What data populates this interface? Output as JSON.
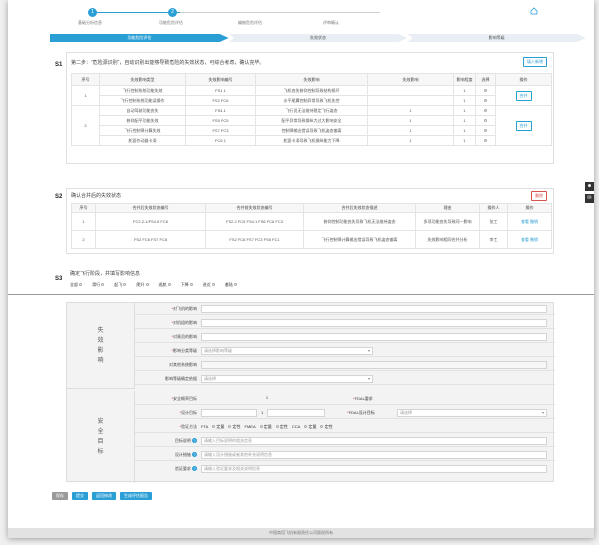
{
  "stepper": {
    "steps": [
      {
        "num": "1",
        "label": "基础分析信息"
      },
      {
        "num": "2",
        "label": "功能危险评估"
      },
      {
        "num": "3",
        "label": "编制危险评估"
      },
      {
        "num": "4",
        "label": "评审确认"
      }
    ]
  },
  "phases": [
    "功能危险评估",
    "失效状态",
    "影响等级"
  ],
  "s1": {
    "tag": "S1",
    "title": "第二步：“危险源识别”，自动识别出能够导致危险的失效状态，可综合考虑，确认完毕。",
    "add_label": "填入新增",
    "headers": [
      "序号",
      "失效影响类型",
      "失效影响编号",
      "失效影响",
      "失效影响",
      "影响程度",
      "选择",
      "操作"
    ],
    "groups": [
      {
        "index": "1",
        "rows": [
          [
            "飞行控制系统功能失效",
            "FS1.1",
            "飞机丧失俯仰控制导致结构损坏",
            "",
            "1"
          ],
          [
            "飞行控制系统功能误操作",
            "FS2 FC6",
            "水平尾翼控制异常导致飞机失控",
            "",
            "1"
          ]
        ],
        "action": "合并"
      },
      {
        "index": "2",
        "rows": [
          [
            "自动驾驶功能丧失",
            "FS4.1",
            "飞行员无法维持稳定飞行姿态",
            "1",
            "1"
          ],
          [
            "俯仰配平功能失效",
            "FS5 FC5",
            "配平异常导致操纵力过大影响安全",
            "1",
            "1"
          ],
          [
            "飞行控制律计算失效",
            "FS7 FC3",
            "控制律输出错误导致飞机姿态偏离",
            "1",
            "1"
          ],
          [
            "舵面作动器卡滞",
            "FC6 1",
            "舵面卡滞导致飞机操纵能力下降",
            "1",
            "1"
          ]
        ],
        "action": "合并"
      }
    ]
  },
  "s2": {
    "tag": "S2",
    "title": "确认合并后的失效状态",
    "delete_label": "删除",
    "headers": [
      "序号",
      "合并后失效状态编号",
      "合并前失效状态编号",
      "合并后失效状态描述",
      "理由",
      "操作人",
      "操作"
    ],
    "rows": [
      [
        "1",
        "FC2.2-1/FS4.5 FC6",
        "FS2.2 FC5 FS4.1 FS6 FC6 FC3",
        "俯仰控制功能丧失导致飞机无法维持姿态",
        "多项功能丧失导致同一影响",
        "张工",
        "查看 撤销"
      ],
      [
        "2",
        "FS2 FC6 FS7 FC6",
        "FS2 FC6 FS7 FC3 FS6 FC1",
        "飞行控制律计算输出错误导致飞机姿态偏离",
        "失效影响相同合并分析",
        "李工",
        "查看 撤销"
      ]
    ]
  },
  "s3": {
    "tag": "S3",
    "title": "确定飞行阶段，并填写影响信息",
    "phases": [
      "全部",
      "滑行",
      "起飞",
      "爬升",
      "巡航",
      "下降",
      "进近",
      "着陆"
    ]
  },
  "form": {
    "impact_group": "失效影响",
    "impact_rows": [
      {
        "label": "对飞机的影响",
        "req": "*",
        "value": "",
        "type": "input"
      },
      {
        "label": "对机组的影响",
        "req": "*",
        "value": "",
        "type": "input"
      },
      {
        "label": "对乘员的影响",
        "req": "*",
        "value": "",
        "type": "input"
      },
      {
        "label": "影响分类等级",
        "req": "*",
        "value": "请选择影响等级",
        "type": "select"
      },
      {
        "label": "对其他系统影响",
        "req": "",
        "value": "",
        "type": "input"
      },
      {
        "label": "影响等级确定依据",
        "req": "",
        "value": "请选择",
        "type": "select"
      }
    ],
    "safety_group": "安全目标",
    "target_label": "安全概率目标",
    "target_req": "*",
    "target_value": "1",
    "fdal_label": "FDAL要求",
    "fdal_req": "*",
    "design_target_label": "设计目标",
    "design_target_req": "*",
    "design_target_value": "1",
    "fdal_target_label": "FDAL设计目标",
    "fdal_target_req": "*",
    "fdal_target_value": "请选择",
    "method_label": "验证方法",
    "method_req": "*",
    "methods": [
      "FTA",
      "定量",
      "定性",
      "FMEA",
      "定量",
      "定性",
      "CCA",
      "定量",
      "定性"
    ],
    "explain_label": "目标说明",
    "explain_placeholder": "请输入目标说明的相关信息",
    "design_label": "设计措施",
    "design_placeholder": "请输入设计措施或者其他补充说明信息",
    "demo_label": "验证要求",
    "demo_placeholder": "请输入验证要求及相关说明信息"
  },
  "footer": {
    "buttons": [
      "保存",
      "提交",
      "返回修改",
      "生成评估报告"
    ]
  },
  "bottom": "中国商用飞机有限责任公司版权所有"
}
